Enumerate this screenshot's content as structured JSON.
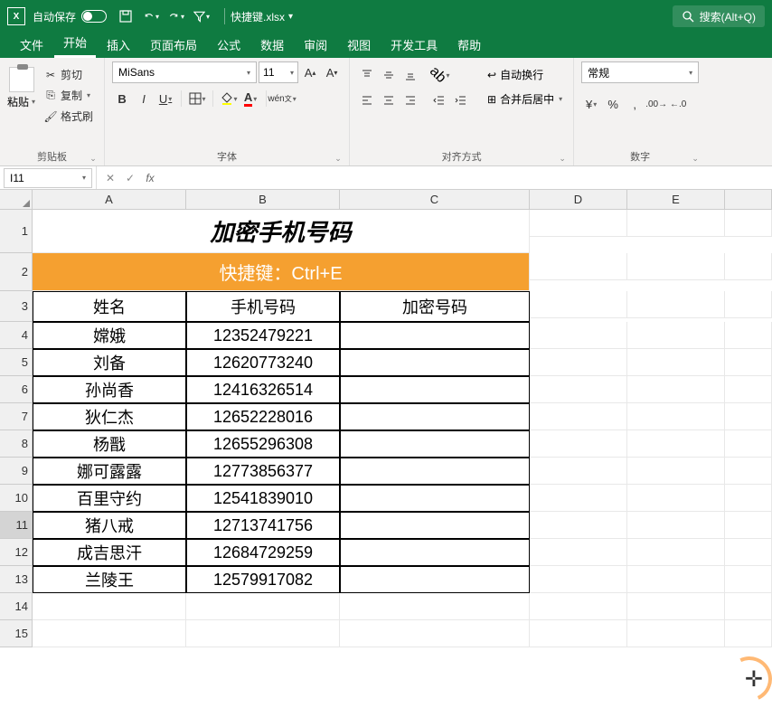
{
  "titlebar": {
    "autosave": "自动保存",
    "filename": "快捷键.xlsx",
    "search": "搜索(Alt+Q)"
  },
  "tabs": [
    "文件",
    "开始",
    "插入",
    "页面布局",
    "公式",
    "数据",
    "审阅",
    "视图",
    "开发工具",
    "帮助"
  ],
  "active_tab": 1,
  "ribbon": {
    "clipboard": {
      "paste": "粘贴",
      "cut": "剪切",
      "copy": "复制",
      "format_painter": "格式刷",
      "label": "剪贴板"
    },
    "font": {
      "name": "MiSans",
      "size": "11",
      "label": "字体"
    },
    "align": {
      "wrap": "自动换行",
      "merge": "合并后居中",
      "label": "对齐方式"
    },
    "number": {
      "format": "常规",
      "label": "数字"
    }
  },
  "namebox": "I11",
  "columns": [
    "A",
    "B",
    "C",
    "D",
    "E"
  ],
  "sheet": {
    "title": "加密手机号码",
    "orange": "快捷键：Ctrl+E",
    "headers": [
      "姓名",
      "手机号码",
      "加密号码"
    ],
    "rows": [
      {
        "name": "嫦娥",
        "phone": "12352479221"
      },
      {
        "name": "刘备",
        "phone": "12620773240"
      },
      {
        "name": "孙尚香",
        "phone": "12416326514"
      },
      {
        "name": "狄仁杰",
        "phone": "12652228016"
      },
      {
        "name": "杨戬",
        "phone": "12655296308"
      },
      {
        "name": "娜可露露",
        "phone": "12773856377"
      },
      {
        "name": "百里守约",
        "phone": "12541839010"
      },
      {
        "name": "猪八戒",
        "phone": "12713741756"
      },
      {
        "name": "成吉思汗",
        "phone": "12684729259"
      },
      {
        "name": "兰陵王",
        "phone": "12579917082"
      }
    ]
  }
}
